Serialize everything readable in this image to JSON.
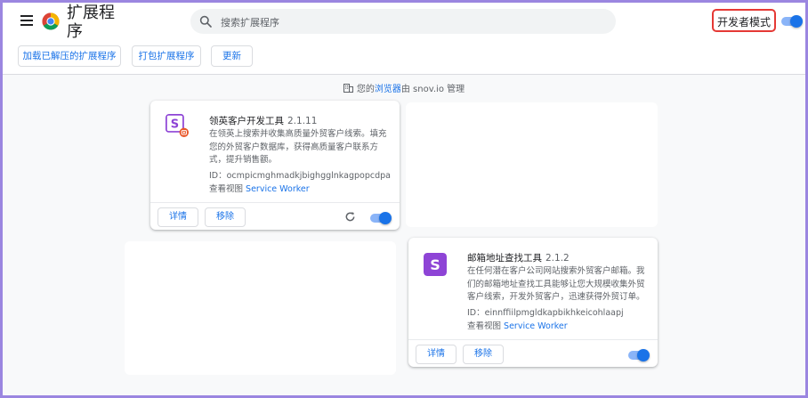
{
  "header": {
    "title": "扩展程序",
    "search_placeholder": "搜索扩展程序",
    "dev_mode_label": "开发者模式",
    "dev_mode_on": true
  },
  "toolbar": {
    "load_unpacked": "加载已解压的扩展程序",
    "pack": "打包扩展程序",
    "update": "更新"
  },
  "managed": {
    "prefix": "您的",
    "link": "浏览器",
    "suffix": "由 snov.io 管理"
  },
  "extensions": [
    {
      "name": "领英客户开发工具",
      "version": "2.1.11",
      "description": "在领英上搜索并收集高质量外贸客户线索。填充您的外贸客户数据库，获得高质量客户联系方式，提升销售额。",
      "id_label": "ID：",
      "id": "ocmpicmghmadkjbighgglnkagpopcdpa",
      "views_label": "查看视图",
      "views_link": "Service Worker",
      "details_label": "详情",
      "remove_label": "移除",
      "enabled": true
    },
    {
      "name": "邮箱地址查找工具",
      "version": "2.1.2",
      "description": "在任何潜在客户公司网站搜索外贸客户邮箱。我们的邮箱地址查找工具能够让您大规模收集外贸客户线索，开发外贸客户，迅速获得外贸订单。",
      "id_label": "ID：",
      "id": "einnffiilpmgldkapbikhkeicohlaapj",
      "views_label": "查看视图",
      "views_link": "Service Worker",
      "details_label": "详情",
      "remove_label": "移除",
      "enabled": true
    }
  ],
  "colors": {
    "accent": "#1a73e8",
    "snov_purple": "#8e44d6",
    "badge_orange": "#e8572a",
    "highlight_red": "#e53935"
  }
}
